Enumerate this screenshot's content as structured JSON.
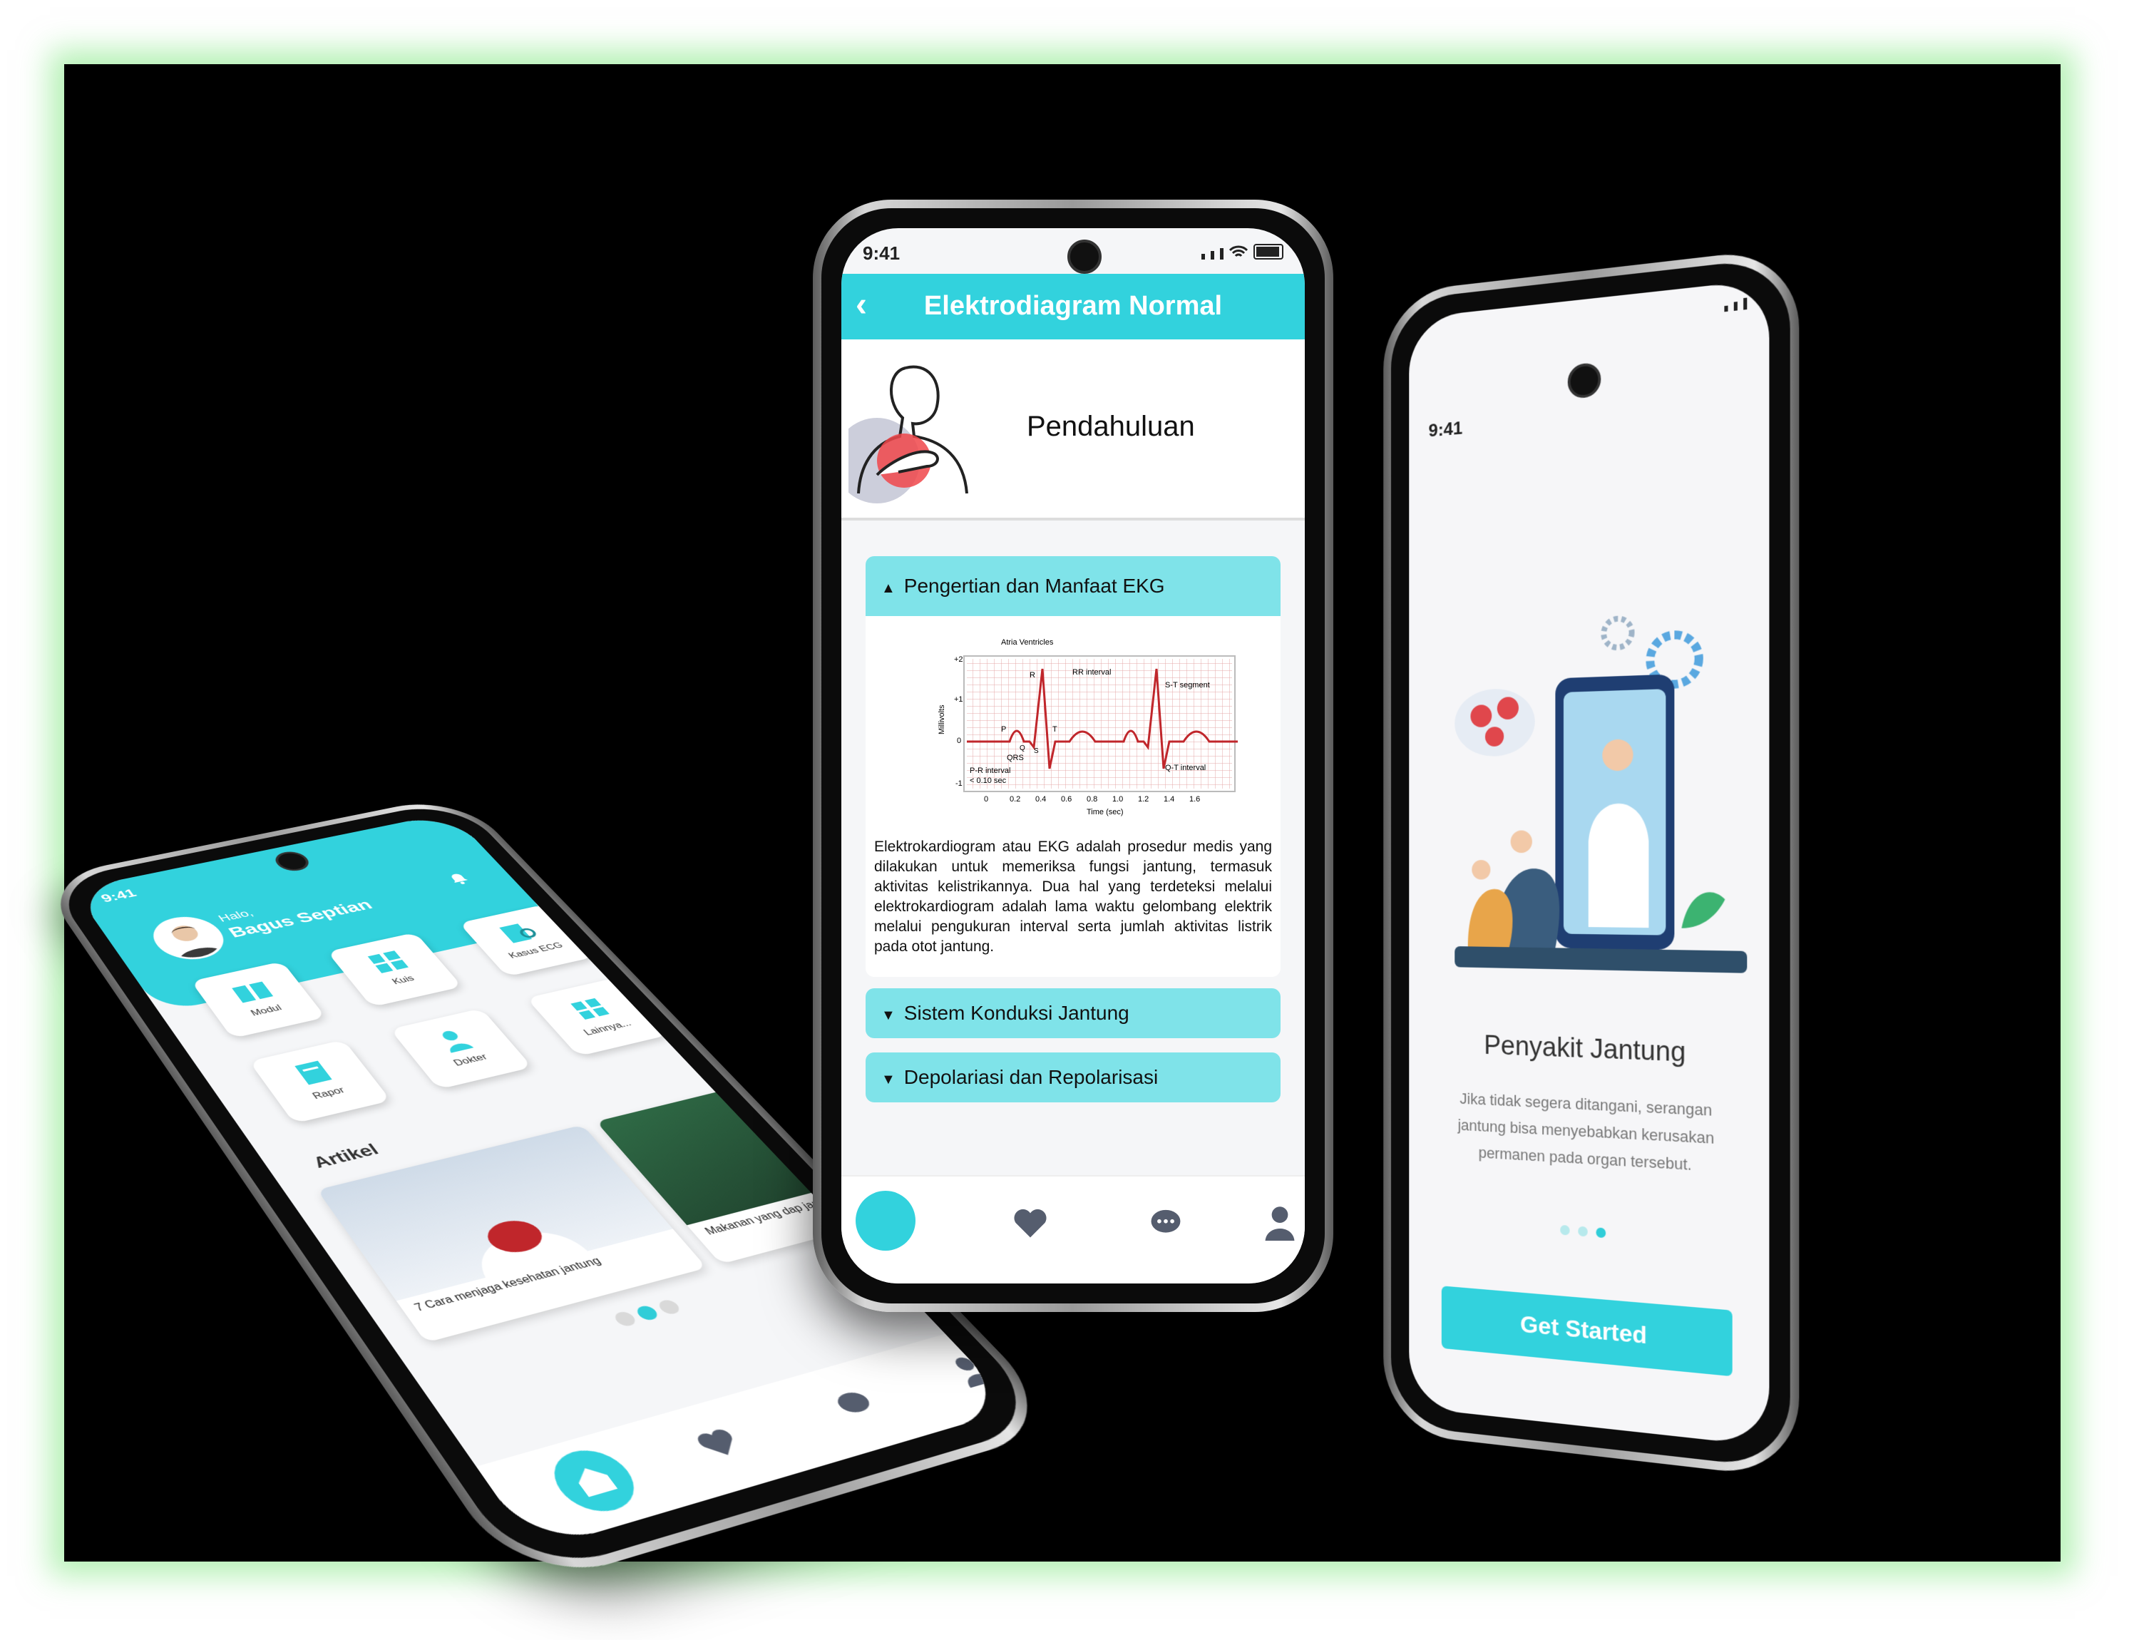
{
  "colors": {
    "accent": "#32d2dd",
    "accent_light": "#7fe3e9",
    "background": "#000000",
    "glow": "#78e678"
  },
  "phone_home": {
    "status_time": "9:41",
    "greeting": "Halo,",
    "user_name": "Bagus Septian",
    "menu": [
      {
        "label": "Modul",
        "icon": "book-icon"
      },
      {
        "label": "Kuis",
        "icon": "quiz-icon"
      },
      {
        "label": "Kasus ECG",
        "icon": "case-icon"
      },
      {
        "label": "Rapor",
        "icon": "report-icon"
      },
      {
        "label": "Dokter",
        "icon": "doctor-icon"
      },
      {
        "label": "Lainnya...",
        "icon": "grid-icon"
      }
    ],
    "section_title": "Artikel",
    "articles": [
      {
        "title": "7 Cara menjaga kesehatan jantung"
      },
      {
        "title": "Makanan yang dap jantung"
      }
    ],
    "carousel_active": 1,
    "nav": [
      "home-icon",
      "heart-icon",
      "chat-icon",
      "user-icon"
    ]
  },
  "phone_ecg": {
    "status_time": "9:41",
    "header_title": "Elektrodiagram Normal",
    "intro_label": "Pendahuluan",
    "sections": [
      {
        "title": "Pengertian dan Manfaat EKG",
        "expanded": true,
        "body": "Elektrokardiogram atau EKG adalah prosedur medis yang dilakukan untuk memeriksa fungsi jantung, termasuk aktivitas kelistrikannya. Dua hal yang terdeteksi melalui elektrokardiogram adalah lama waktu gelombang elektrik melalui pengukuran interval serta jumlah aktivitas listrik pada otot jantung."
      },
      {
        "title": "Sistem Konduksi Jantung",
        "expanded": false
      },
      {
        "title": "Depolariasi dan Repolarisasi",
        "expanded": false
      }
    ],
    "ecg_figure": {
      "labels": [
        "Atria Ventricles",
        "RR interval",
        "S-T segment",
        "P-R interval",
        "QRS",
        "Q-T interval",
        "P",
        "R",
        "T",
        "Q",
        "S",
        "< 0.10 sec",
        "Millivolts",
        "Time (sec)"
      ],
      "y_ticks": [
        "+2",
        "+1",
        "0",
        "-1"
      ],
      "x_ticks": [
        "0",
        "0.2",
        "0.4",
        "0.6",
        "0.8",
        "1.0",
        "1.2",
        "1.4",
        "1.6"
      ]
    },
    "nav": [
      "home-icon",
      "heart-icon",
      "chat-icon",
      "user-icon"
    ]
  },
  "phone_onboarding": {
    "status_time": "9:41",
    "title": "Penyakit Jantung",
    "description": "Jika tidak segera ditangani, serangan jantung bisa menyebabkan kerusakan permanen pada organ tersebut.",
    "page_index": 3,
    "page_count": 3,
    "cta": "Get Started"
  }
}
